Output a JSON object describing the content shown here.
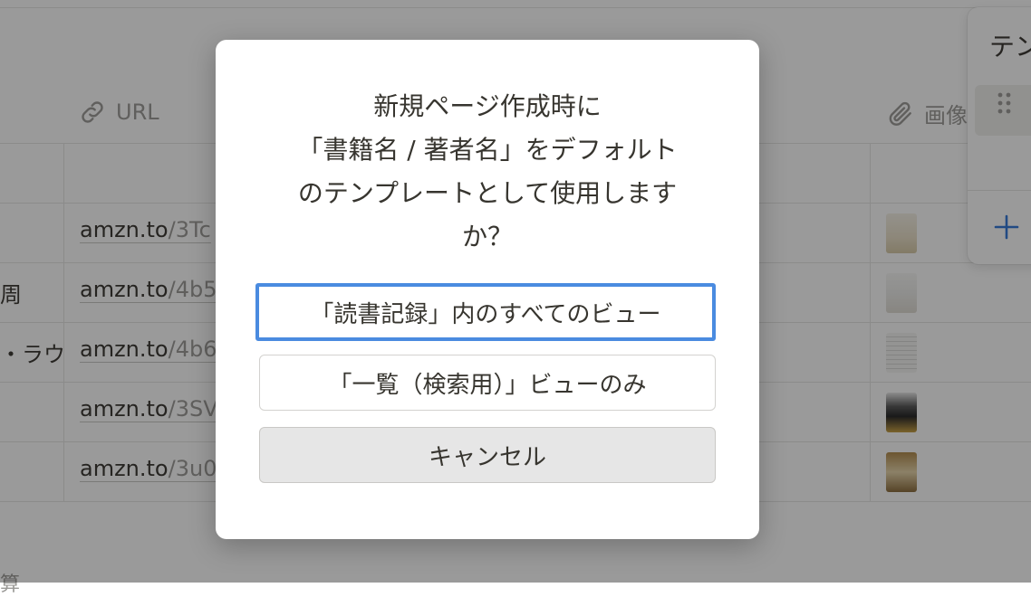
{
  "table": {
    "columns": {
      "url_header": "URL",
      "image_header": "画像"
    },
    "rows": [
      {
        "title": "",
        "url_host": "amzn.to",
        "url_path": "/3Tc"
      },
      {
        "title": "周",
        "url_host": "amzn.to",
        "url_path": "/4b5"
      },
      {
        "title": "・ラウ",
        "url_host": "amzn.to",
        "url_path": "/4b6"
      },
      {
        "title": "",
        "url_host": "amzn.to",
        "url_path": "/3SV"
      },
      {
        "title": "",
        "url_host": "amzn.to",
        "url_path": "/3u0"
      }
    ],
    "footer_text": "算"
  },
  "template_panel": {
    "title": "テンプ"
  },
  "dialog": {
    "message_lines": [
      "新規ページ作成時に",
      "「書籍名 / 著者名」をデフォルト",
      "のテンプレートとして使用します",
      "か？"
    ],
    "btn_all_views": "「読書記録」内のすべてのビュー",
    "btn_one_view": "「一覧（検索用）」ビューのみ",
    "btn_cancel": "キャンセル"
  },
  "colors": {
    "focus_ring": "#4a8be0",
    "overlay": "rgba(15,15,15,0.42)",
    "cancel_bg": "#e6e6e6"
  },
  "icons": {
    "url_column": "link-icon",
    "image_column": "paperclip-icon",
    "drag": "drag-handle-icon",
    "add": "plus-icon"
  }
}
